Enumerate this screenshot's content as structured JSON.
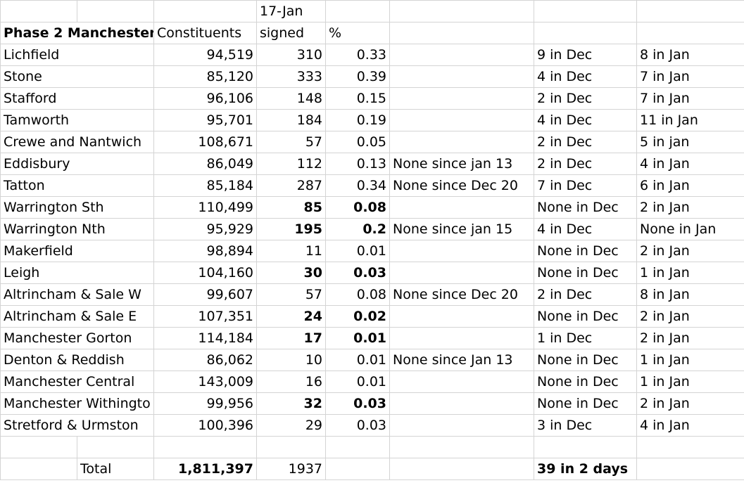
{
  "header": {
    "date": "17-Jan",
    "title": "Phase 2 Manchester",
    "col_constituents": "Constituents",
    "col_signed": "signed",
    "col_percent": "%"
  },
  "rows": [
    {
      "name": "Lichfield",
      "constituents": "94,519",
      "signed": "310",
      "percent": "0.33",
      "note": "",
      "dec": "9 in Dec",
      "jan": "8 in Jan",
      "bold": false
    },
    {
      "name": "Stone",
      "constituents": "85,120",
      "signed": "333",
      "percent": "0.39",
      "note": "",
      "dec": "4 in Dec",
      "jan": "7 in Jan",
      "bold": false
    },
    {
      "name": "Stafford",
      "constituents": "96,106",
      "signed": "148",
      "percent": "0.15",
      "note": "",
      "dec": "2 in Dec",
      "jan": "7 in Jan",
      "bold": false
    },
    {
      "name": "Tamworth",
      "constituents": "95,701",
      "signed": "184",
      "percent": "0.19",
      "note": "",
      "dec": "4 in Dec",
      "jan": "11 in Jan",
      "bold": false
    },
    {
      "name": "Crewe and Nantwich",
      "constituents": "108,671",
      "signed": "57",
      "percent": "0.05",
      "note": "",
      "dec": "2 in Dec",
      "jan": "5 in jan",
      "bold": false
    },
    {
      "name": "Eddisbury",
      "constituents": "86,049",
      "signed": "112",
      "percent": "0.13",
      "note": "None since jan 13",
      "dec": "2 in Dec",
      "jan": "4 in Jan",
      "bold": false
    },
    {
      "name": "Tatton",
      "constituents": "85,184",
      "signed": "287",
      "percent": "0.34",
      "note": "None since Dec 20",
      "dec": "7 in Dec",
      "jan": "6 in Jan",
      "bold": false
    },
    {
      "name": "Warrington Sth",
      "constituents": "110,499",
      "signed": "85",
      "percent": "0.08",
      "note": "",
      "dec": "None in Dec",
      "jan": "2 in Jan",
      "bold": true
    },
    {
      "name": "Warrington Nth",
      "constituents": "95,929",
      "signed": "195",
      "percent": "0.2",
      "note": "None since jan 15",
      "dec": "4 in Dec",
      "jan": "None in Jan",
      "bold": true
    },
    {
      "name": "Makerfield",
      "constituents": "98,894",
      "signed": "11",
      "percent": "0.01",
      "note": "",
      "dec": "None in Dec",
      "jan": "2 in Jan",
      "bold": false
    },
    {
      "name": "Leigh",
      "constituents": "104,160",
      "signed": "30",
      "percent": "0.03",
      "note": "",
      "dec": "None in Dec",
      "jan": "1 in Jan",
      "bold": true
    },
    {
      "name": "Altrincham & Sale W",
      "constituents": "99,607",
      "signed": "57",
      "percent": "0.08",
      "note": "None since Dec 20",
      "dec": "2 in Dec",
      "jan": "8 in Jan",
      "bold": false
    },
    {
      "name": "Altrincham & Sale E",
      "constituents": "107,351",
      "signed": "24",
      "percent": "0.02",
      "note": "",
      "dec": "None in Dec",
      "jan": "2 in Jan",
      "bold": true
    },
    {
      "name": "Manchester Gorton",
      "constituents": "114,184",
      "signed": "17",
      "percent": "0.01",
      "note": "",
      "dec": "1 in Dec",
      "jan": "2 in Jan",
      "bold": true
    },
    {
      "name": "Denton & Reddish",
      "constituents": "86,062",
      "signed": "10",
      "percent": "0.01",
      "note": "None since Jan 13",
      "dec": "None in Dec",
      "jan": "1 in Jan",
      "bold": false
    },
    {
      "name": "Manchester Central",
      "constituents": "143,009",
      "signed": "16",
      "percent": "0.01",
      "note": "",
      "dec": "None in Dec",
      "jan": "1 in Jan",
      "bold": false
    },
    {
      "name": "Manchester Withingto",
      "constituents": "99,956",
      "signed": "32",
      "percent": "0.03",
      "note": "",
      "dec": "None in Dec",
      "jan": "2 in Jan",
      "bold": true
    },
    {
      "name": "Stretford & Urmston",
      "constituents": "100,396",
      "signed": "29",
      "percent": "0.03",
      "note": "",
      "dec": "3 in Dec",
      "jan": "4 in Jan",
      "bold": false
    }
  ],
  "total": {
    "label": "Total",
    "constituents": "1,811,397",
    "signed": "1937",
    "summary": "39 in 2 days"
  }
}
